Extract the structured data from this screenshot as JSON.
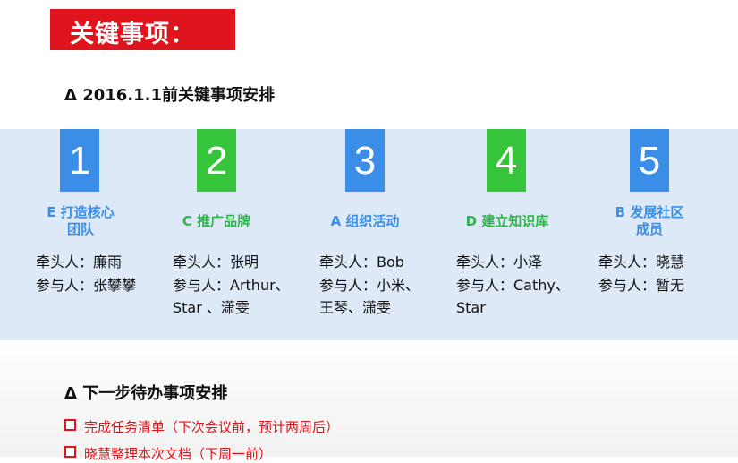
{
  "title": "关键事项：",
  "section1": {
    "heading": "Δ  2016.1.1前关键事项安排"
  },
  "items": [
    {
      "num": "1",
      "num_color": "#3b8ee8",
      "cat_line1": "E 打造核心",
      "cat_line2": "团队",
      "cat_color": "#3b8ee8",
      "lead": "牵头人：廉雨",
      "members1": "参与人：张攀攀",
      "members2": ""
    },
    {
      "num": "2",
      "num_color": "#35c43a",
      "cat_line1": "C 推广品牌",
      "cat_line2": "",
      "cat_color": "#2fb64b",
      "lead": "牵头人：张明",
      "members1": "参与人：Arthur、",
      "members2": "Star 、潇雯"
    },
    {
      "num": "3",
      "num_color": "#3b8ee8",
      "cat_line1": "A 组织活动",
      "cat_line2": "",
      "cat_color": "#3b8ee8",
      "lead": "牵头人：Bob",
      "members1": "参与人：小米、",
      "members2": "王琴、潇雯"
    },
    {
      "num": "4",
      "num_color": "#35c43a",
      "cat_line1": "D 建立知识库",
      "cat_line2": "",
      "cat_color": "#2fb64b",
      "lead": "牵头人：小泽",
      "members1": "参与人：Cathy、",
      "members2": "Star"
    },
    {
      "num": "5",
      "num_color": "#3b8ee8",
      "cat_line1": "B 发展社区",
      "cat_line2": "成员",
      "cat_color": "#3b8ee8",
      "lead": "牵头人：晓慧",
      "members1": "参与人：暂无",
      "members2": ""
    }
  ],
  "section2": {
    "heading": "Δ  下一步待办事项安排",
    "todos": [
      "完成任务清单（下次会议前，预计两周后）",
      "晓慧整理本次文档（下周一前）"
    ]
  },
  "colors": {
    "accent_red": "#e0141c",
    "blue": "#3b8ee8",
    "green": "#35c43a",
    "band": "#dde9f7"
  }
}
